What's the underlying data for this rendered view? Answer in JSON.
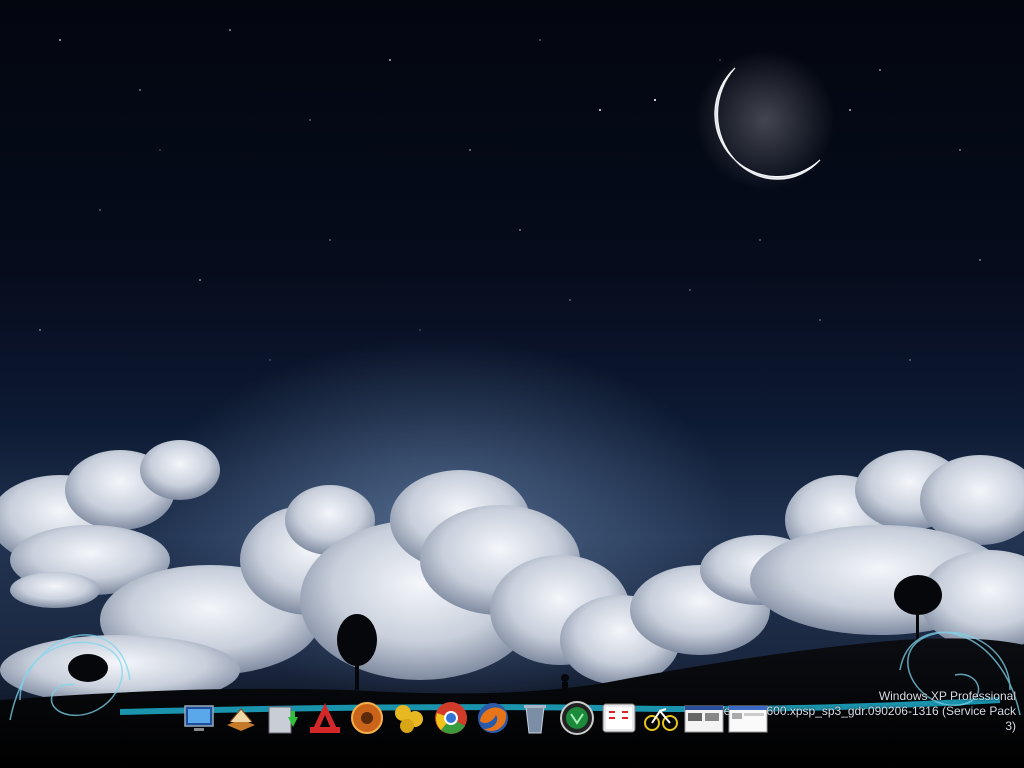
{
  "system_watermark": {
    "line1": "Windows XP Professional",
    "line2": "Version 2600.xpsp_sp3_gdr.090206-1316 (Service Pack 3)"
  },
  "dock": {
    "items": [
      {
        "name": "my-computer-icon"
      },
      {
        "name": "dictionary-book-icon"
      },
      {
        "name": "download-folder-icon"
      },
      {
        "name": "autocad-icon"
      },
      {
        "name": "tools-gear-icon"
      },
      {
        "name": "yellow-balls-app-icon"
      },
      {
        "name": "chrome-icon"
      },
      {
        "name": "firefox-icon"
      },
      {
        "name": "recycle-bin-icon"
      },
      {
        "name": "green-orb-app-icon"
      },
      {
        "name": "calendar-clock-icon"
      },
      {
        "name": "bicycle-app-icon"
      },
      {
        "name": "window-thumbnail-1-icon"
      },
      {
        "name": "window-thumbnail-2-icon"
      }
    ]
  }
}
